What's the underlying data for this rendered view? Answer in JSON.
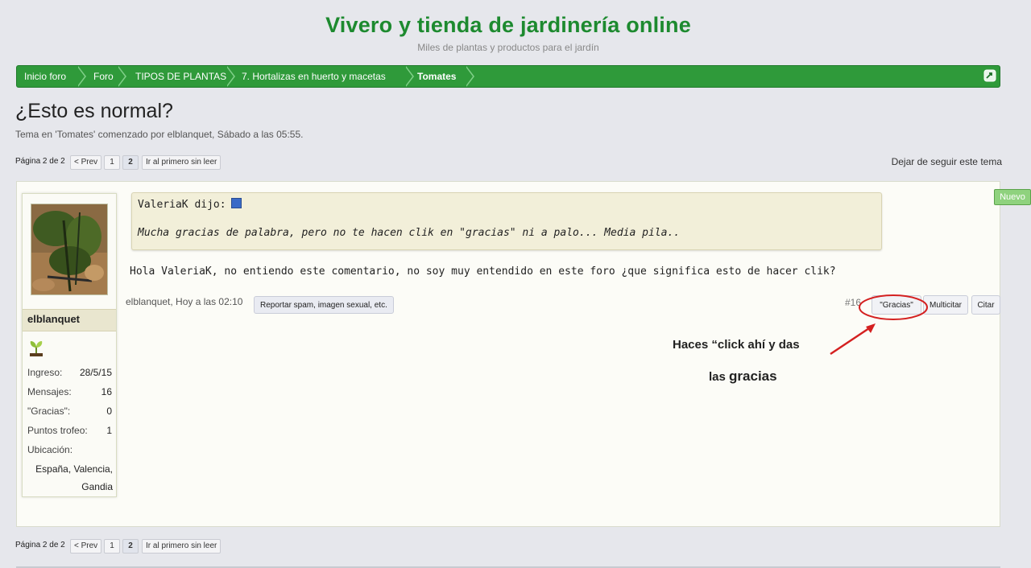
{
  "header": {
    "site_title": "Vivero y tienda de jardinería online",
    "site_subtitle": "Miles de plantas y productos para el jardín"
  },
  "breadcrumb": {
    "items": [
      {
        "label": "Inicio foro"
      },
      {
        "label": "Foro"
      },
      {
        "label": "TIPOS DE PLANTAS"
      },
      {
        "label": "7. Hortalizas en huerto y macetas"
      },
      {
        "label": "Tomates"
      }
    ],
    "icon": "jump-arrow-icon"
  },
  "thread": {
    "title": "¿Esto es normal?",
    "meta": "Tema en 'Tomates' comenzado por elblanquet, Sábado a las 05:55.",
    "unfollow_label": "Dejar de seguir este tema",
    "new_badge": "Nuevo"
  },
  "pagination": {
    "label": "Página 2 de 2",
    "prev": "< Prev",
    "pages": [
      "1",
      "2"
    ],
    "current_page": "2",
    "first_unread": "Ir al primero sin leer"
  },
  "author": {
    "username": "elblanquet",
    "stats": [
      {
        "label": "Ingreso:",
        "value": "28/5/15"
      },
      {
        "label": "Mensajes:",
        "value": "16"
      },
      {
        "label": "\"Gracias\":",
        "value": "0"
      },
      {
        "label": "Puntos trofeo:",
        "value": "1"
      }
    ],
    "location_label": "Ubicación:",
    "location_line1": "España, Valencia,",
    "location_line2": "Gandia"
  },
  "post": {
    "quote_author": "ValeriaK dijo:",
    "quote_text": "Mucha gracias de palabra, pero no te hacen clik en \"gracias\" ni a palo... Media pila..",
    "body": "Hola ValeriaK, no entiendo este comentario, no soy muy entendido en este foro ¿que significa esto de hacer clik?",
    "meta": "elblanquet, Hoy a las 02:10",
    "report_label": "Reportar spam, imagen sexual, etc.",
    "number": "#16",
    "gracias_label": "\"Gracias\"",
    "multicitar_label": "Multicitar",
    "citar_label": "Citar"
  },
  "annotation": {
    "line1": "Haces “click ahí y  das",
    "line2_prefix": "las ",
    "line2_bold": "gracias",
    "color": "#d42020"
  },
  "colors": {
    "accent_green": "#2f9a3a",
    "title_green": "#1d8a2f",
    "quote_bg": "#f2efd9"
  }
}
